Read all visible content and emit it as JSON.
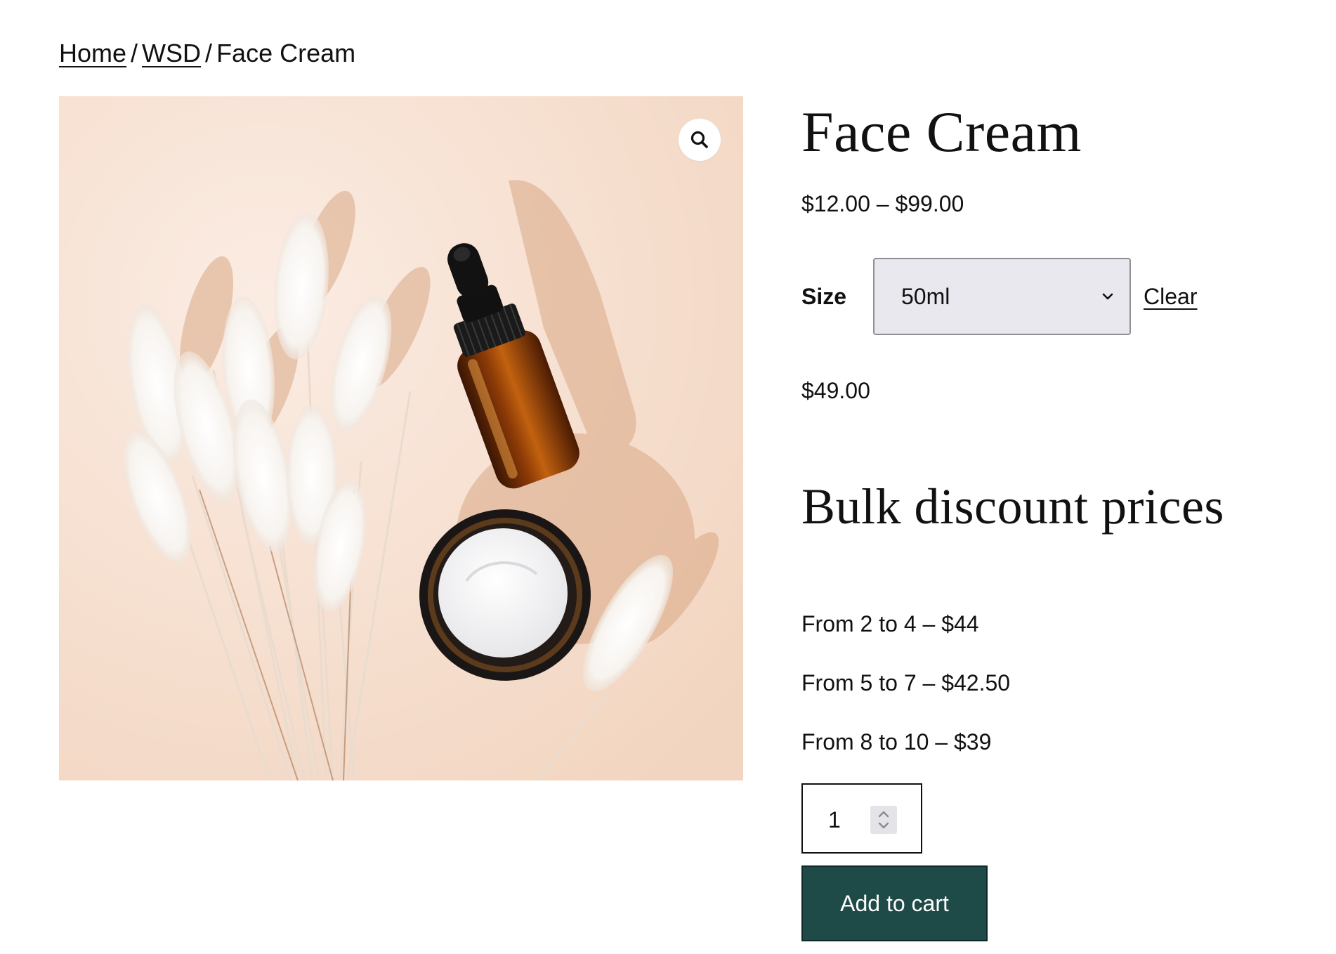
{
  "breadcrumb": {
    "home": "Home",
    "category": "WSD",
    "current": "Face Cream",
    "separator": "/"
  },
  "product": {
    "title": "Face Cream",
    "price_range": "$12.00 – $99.00",
    "image_alt": "Amber dropper bottle and jar of white face cream beside dried bunny tail grass",
    "zoom_icon": "magnifier-icon"
  },
  "variation": {
    "label": "Size",
    "selected": "50ml",
    "clear_label": "Clear",
    "price": "$49.00"
  },
  "bulk": {
    "heading": "Bulk discount prices",
    "tiers": [
      "From 2 to 4 – $44",
      "From 5 to 7 – $42.50",
      "From 8 to 10 – $39"
    ]
  },
  "cart": {
    "quantity": "1",
    "add_label": "Add to cart",
    "button_color": "#1e4a47"
  }
}
